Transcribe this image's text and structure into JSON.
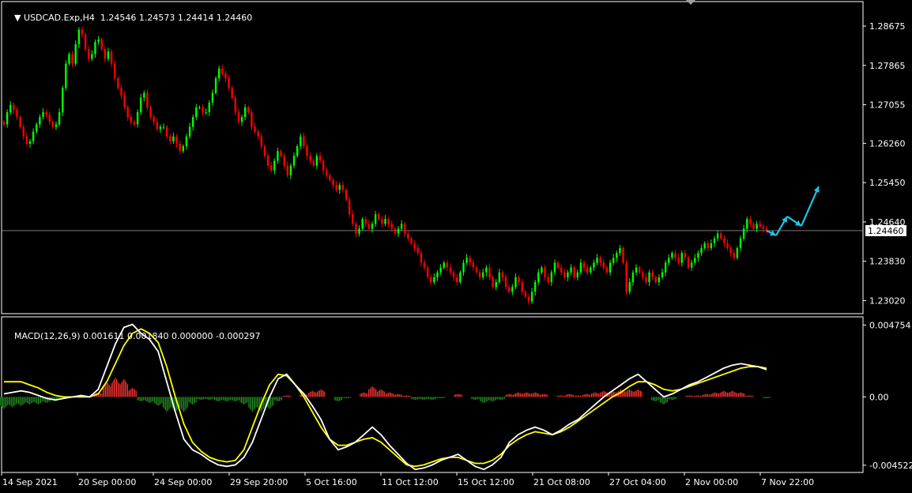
{
  "header": {
    "symbol": "USDCAD.Exp,H4",
    "ohlc": "1.24546 1.24573 1.24414 1.24460"
  },
  "macd_header": {
    "label": "MACD(12,26,9)",
    "values": "0.001611 0.001840 0.000000 -0.000297"
  },
  "colors": {
    "background": "#000000",
    "bull_candle": "#00ff00",
    "bear_candle": "#ff0000",
    "grid_line": "#c0c0c0",
    "macd_line": "#ffffff",
    "signal_line": "#ffff00",
    "hist_pos": "#ff3333",
    "hist_neg": "#228b22",
    "arrow": "#20c4e0",
    "price_box_bg": "#ffffff"
  },
  "chart_data": [
    {
      "type": "candlestick",
      "name": "price",
      "price_axis_labels": [
        "1.28675",
        "1.27865",
        "1.27055",
        "1.26260",
        "1.25450",
        "1.24640",
        "1.23830",
        "1.23020"
      ],
      "current_price": "1.24460",
      "ylim": [
        1.2275,
        1.2918
      ],
      "closes": [
        1.2665,
        1.269,
        1.2705,
        1.2695,
        1.268,
        1.266,
        1.264,
        1.2625,
        1.263,
        1.265,
        1.2665,
        1.268,
        1.269,
        1.2685,
        1.267,
        1.266,
        1.2665,
        1.269,
        1.274,
        1.279,
        1.281,
        1.279,
        1.283,
        1.286,
        1.285,
        1.282,
        1.28,
        1.281,
        1.2835,
        1.284,
        1.282,
        1.28,
        1.2815,
        1.279,
        1.276,
        1.274,
        1.2725,
        1.27,
        1.268,
        1.267,
        1.2665,
        1.269,
        1.272,
        1.273,
        1.27,
        1.268,
        1.267,
        1.2655,
        1.266,
        1.266,
        1.264,
        1.263,
        1.264,
        1.2625,
        1.261,
        1.262,
        1.264,
        1.266,
        1.268,
        1.27,
        1.27,
        1.269,
        1.269,
        1.271,
        1.273,
        1.276,
        1.278,
        1.277,
        1.276,
        1.274,
        1.272,
        1.269,
        1.267,
        1.268,
        1.27,
        1.269,
        1.266,
        1.265,
        1.264,
        1.262,
        1.26,
        1.258,
        1.257,
        1.259,
        1.261,
        1.26,
        1.258,
        1.256,
        1.258,
        1.26,
        1.262,
        1.264,
        1.262,
        1.26,
        1.259,
        1.258,
        1.26,
        1.259,
        1.257,
        1.256,
        1.255,
        1.254,
        1.253,
        1.254,
        1.253,
        1.251,
        1.248,
        1.246,
        1.244,
        1.245,
        1.247,
        1.246,
        1.245,
        1.246,
        1.248,
        1.247,
        1.246,
        1.247,
        1.246,
        1.245,
        1.244,
        1.245,
        1.246,
        1.244,
        1.243,
        1.242,
        1.241,
        1.24,
        1.238,
        1.237,
        1.235,
        1.234,
        1.235,
        1.236,
        1.237,
        1.238,
        1.237,
        1.236,
        1.235,
        1.234,
        1.236,
        1.238,
        1.239,
        1.238,
        1.237,
        1.236,
        1.235,
        1.236,
        1.237,
        1.235,
        1.233,
        1.234,
        1.236,
        1.235,
        1.233,
        1.232,
        1.233,
        1.235,
        1.234,
        1.232,
        1.231,
        1.23,
        1.232,
        1.234,
        1.236,
        1.237,
        1.235,
        1.234,
        1.236,
        1.238,
        1.237,
        1.236,
        1.235,
        1.236,
        1.237,
        1.235,
        1.236,
        1.238,
        1.237,
        1.236,
        1.237,
        1.238,
        1.239,
        1.238,
        1.237,
        1.236,
        1.238,
        1.239,
        1.24,
        1.241,
        1.238,
        1.232,
        1.234,
        1.236,
        1.237,
        1.236,
        1.235,
        1.234,
        1.236,
        1.235,
        1.234,
        1.235,
        1.236,
        1.238,
        1.239,
        1.24,
        1.239,
        1.238,
        1.24,
        1.239,
        1.237,
        1.238,
        1.239,
        1.24,
        1.241,
        1.242,
        1.241,
        1.242,
        1.243,
        1.244,
        1.243,
        1.242,
        1.241,
        1.24,
        1.239,
        1.241,
        1.243,
        1.245,
        1.247,
        1.246,
        1.245,
        1.246,
        1.2455,
        1.245,
        1.2446
      ],
      "projection_arrows": "4 cyan zig-zag arrows extending up-right from last candle"
    },
    {
      "type": "macd",
      "name": "MACD(12,26,9)",
      "axis_labels": [
        "0.004754",
        "0.00",
        "-0.004522"
      ],
      "ylim": [
        -0.005,
        0.0053
      ],
      "macd": [
        0.0002,
        0.0003,
        0.0004,
        0.0003,
        0.0001,
        -0.0001,
        -0.0002,
        -0.0001,
        0.0,
        0.0001,
        0.0,
        0.0005,
        0.002,
        0.0035,
        0.0046,
        0.0048,
        0.0042,
        0.0038,
        0.003,
        0.001,
        -0.001,
        -0.0028,
        -0.0035,
        -0.0038,
        -0.0042,
        -0.0045,
        -0.0046,
        -0.0045,
        -0.004,
        -0.003,
        -0.0015,
        0.0,
        0.0012,
        0.0015,
        0.0008,
        0.0002,
        -0.0006,
        -0.0015,
        -0.0028,
        -0.0035,
        -0.0033,
        -0.003,
        -0.0025,
        -0.002,
        -0.0025,
        -0.0032,
        -0.0038,
        -0.0044,
        -0.0048,
        -0.0047,
        -0.0045,
        -0.0042,
        -0.004,
        -0.0038,
        -0.0042,
        -0.0046,
        -0.0048,
        -0.0045,
        -0.004,
        -0.003,
        -0.0025,
        -0.0022,
        -0.002,
        -0.0022,
        -0.0025,
        -0.0022,
        -0.0018,
        -0.0015,
        -0.001,
        -0.0005,
        0.0,
        0.0004,
        0.0008,
        0.0012,
        0.0015,
        0.001,
        0.0005,
        0.0,
        0.0002,
        0.0005,
        0.0008,
        0.001,
        0.0013,
        0.0016,
        0.0019,
        0.0021,
        0.0022,
        0.0021,
        0.002,
        0.0018
      ],
      "signal": [
        0.001,
        0.001,
        0.001,
        0.0008,
        0.0006,
        0.0003,
        0.0001,
        0.0,
        0.0,
        0.0,
        0.0,
        0.0002,
        0.001,
        0.0022,
        0.0034,
        0.0042,
        0.0045,
        0.0042,
        0.0036,
        0.002,
        0.0,
        -0.0018,
        -0.003,
        -0.0036,
        -0.004,
        -0.0042,
        -0.0043,
        -0.0042,
        -0.0035,
        -0.002,
        -0.0005,
        0.0008,
        0.0015,
        0.0014,
        0.0008,
        0.0,
        -0.001,
        -0.002,
        -0.0028,
        -0.0032,
        -0.0032,
        -0.003,
        -0.0028,
        -0.0027,
        -0.003,
        -0.0035,
        -0.004,
        -0.0045,
        -0.0046,
        -0.0045,
        -0.0043,
        -0.0041,
        -0.004,
        -0.004,
        -0.0042,
        -0.0044,
        -0.0044,
        -0.0042,
        -0.0038,
        -0.0032,
        -0.0028,
        -0.0025,
        -0.0023,
        -0.0024,
        -0.0025,
        -0.0023,
        -0.002,
        -0.0016,
        -0.0012,
        -0.0008,
        -0.0004,
        0.0,
        0.0003,
        0.0007,
        0.001,
        0.001,
        0.0008,
        0.0005,
        0.0004,
        0.0005,
        0.0007,
        0.0009,
        0.0011,
        0.0013,
        0.0015,
        0.0017,
        0.0019,
        0.002,
        0.002,
        0.0019
      ],
      "histogram": [
        -0.0008,
        -0.0007,
        -0.0006,
        -0.0005,
        -0.0005,
        -0.0004,
        -0.0003,
        -0.0001,
        0.0,
        0.0001,
        0.0,
        0.0003,
        0.001,
        0.0013,
        0.0012,
        0.0006,
        -0.0003,
        -0.0004,
        -0.0006,
        -0.001,
        -0.001,
        -0.001,
        -0.0005,
        -0.0002,
        -0.0002,
        -0.0003,
        -0.0003,
        -0.0003,
        -0.0005,
        -0.001,
        -0.001,
        -0.0008,
        -0.0003,
        0.0001,
        0.0,
        0.0002,
        0.0004,
        0.0005,
        0.0,
        -0.0003,
        -0.0001,
        0.0,
        0.0003,
        0.0007,
        0.0005,
        0.0003,
        0.0002,
        0.0001,
        -0.0002,
        -0.0002,
        -0.0002,
        -0.0001,
        0.0,
        0.0002,
        0.0,
        -0.0002,
        -0.0004,
        -0.0003,
        -0.0002,
        0.0002,
        0.0003,
        0.0003,
        0.0003,
        0.0002,
        0.0,
        0.0001,
        0.0002,
        0.0001,
        0.0002,
        0.0003,
        0.0004,
        0.0004,
        0.0005,
        0.0005,
        0.0005,
        0.0,
        -0.0003,
        -0.0005,
        -0.0002,
        0.0,
        0.0001,
        0.0001,
        0.0002,
        0.0003,
        0.0004,
        0.0004,
        0.0003,
        0.0001,
        0.0,
        -0.0001
      ],
      "time_labels": [
        "14 Sep 2021",
        "20 Sep 00:00",
        "24 Sep 00:00",
        "29 Sep 20:00",
        "5 Oct 16:00",
        "11 Oct 12:00",
        "15 Oct 12:00",
        "21 Oct 08:00",
        "27 Oct 04:00",
        "2 Nov 00:00",
        "7 Nov 22:00"
      ]
    }
  ]
}
